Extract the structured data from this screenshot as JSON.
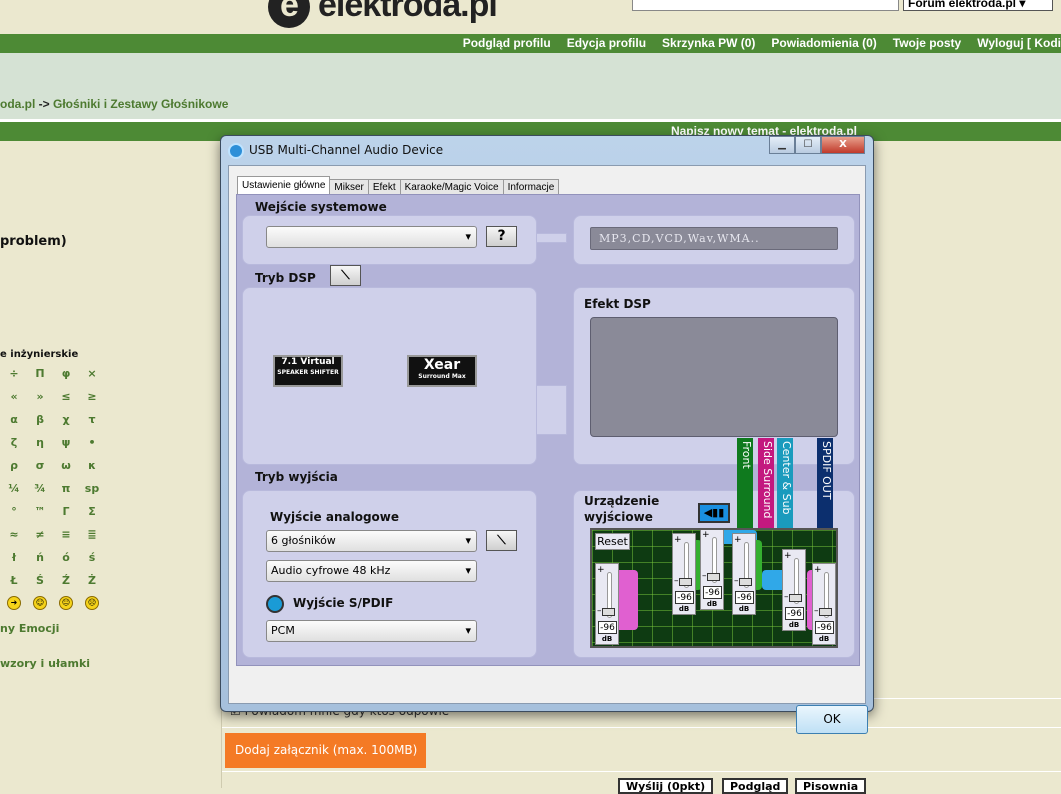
{
  "site": {
    "logo": "elektroda.pl",
    "forum_select": "Forum elektroda.pl"
  },
  "nav": [
    "Podgląd profilu",
    "Edycja profilu",
    "Skrzynka PW (0)",
    "Powiadomienia (0)",
    "Twoje posty",
    "Wyloguj [ Kodi"
  ],
  "breadcrumb": {
    "root": "oda.pl",
    "sep": " -> ",
    "current": "Głośniki i Zestawy Głośnikowe"
  },
  "section_title": "Napisz nowy temat - elektroda.pl",
  "left": {
    "problem": "problem)",
    "symbols_title": "e inżynierskie",
    "symbols": [
      [
        "÷",
        "Π",
        "φ",
        "×"
      ],
      [
        "«",
        "»",
        "≤",
        "≥"
      ],
      [
        "α",
        "β",
        "χ",
        "τ"
      ],
      [
        "ζ",
        "η",
        "ψ",
        "•"
      ],
      [
        "ρ",
        "σ",
        "ω",
        "κ"
      ],
      [
        "¼",
        "¾",
        "π",
        "sp"
      ],
      [
        "°",
        "™",
        "Γ",
        "Σ"
      ],
      [
        "≈",
        "≠",
        "≡",
        "≣"
      ],
      [
        "ł",
        "ń",
        "ó",
        "ś"
      ],
      [
        "Ł",
        "Ś",
        "Ź",
        "Ż"
      ]
    ],
    "emoticons": [
      "➜",
      "☺",
      "😐",
      "☹"
    ],
    "emotions_link": "ny Emocji",
    "formulas_link": "wzory i ułamki"
  },
  "notify_text": "Powiadom mnie gdy ktoś odpowie",
  "attach_button": "Dodaj załącznik (max. 100MB)",
  "post_buttons": [
    "Wyślij (0pkt)",
    "Podgląd",
    "Pisownia"
  ],
  "dialog": {
    "title": "USB Multi-Channel Audio Device",
    "tabs": [
      "Ustawienie główne",
      "Mikser",
      "Efekt",
      "Karaoke/Magic Voice",
      "Informacje"
    ],
    "system_input_label": "Wejście systemowe",
    "system_input_value": "",
    "help_button": "?",
    "formats": "MP3,CD,VCD,Wav,WMA..",
    "dsp_mode_label": "Tryb DSP",
    "dsp_logos": {
      "virtual": "7.1 Virtual",
      "virtual_sub": "SPEAKER SHIFTER",
      "xear": "Xear",
      "xear_sub": "Surround Max"
    },
    "dsp_effect_label": "Efekt DSP",
    "output_mode_label": "Tryb wyjścia",
    "analog_output_label": "Wyjście analogowe",
    "speakers_value": "6 głośników",
    "digital_value": "Audio cyfrowe 48 kHz",
    "spdif_label": "Wyjście S/PDIF",
    "spdif_value": "PCM",
    "output_device_label": "Urządzenie wyjściowe",
    "channels": [
      {
        "name": "Front",
        "color": "#0f7a1e"
      },
      {
        "name": "Side Surround",
        "color": "#c3187f"
      },
      {
        "name": "Center & Sub",
        "color": "#1a9bbd"
      },
      {
        "name": "SPDIF OUT",
        "color": "#0c2f6e"
      }
    ],
    "reset_button": "Reset",
    "sliders": [
      {
        "value": "-96",
        "unit": "dB"
      },
      {
        "value": "-96",
        "unit": "dB"
      },
      {
        "value": "-96",
        "unit": "dB"
      },
      {
        "value": "-96",
        "unit": "dB"
      },
      {
        "value": "-96",
        "unit": "dB"
      },
      {
        "value": "-96",
        "unit": "dB"
      }
    ],
    "ok_button": "OK"
  }
}
